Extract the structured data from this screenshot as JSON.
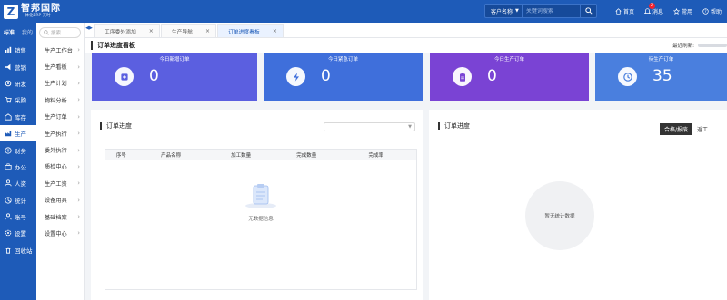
{
  "header": {
    "logo_letter": "Z",
    "brand_name": "智邦国际",
    "brand_slogan": "一体化ERP·天时",
    "search_scope": "客户名称",
    "search_placeholder": "关键词搜索",
    "actions": [
      {
        "icon": "home-icon",
        "label": "首页"
      },
      {
        "icon": "message-icon",
        "label": "消息",
        "badge": "2"
      },
      {
        "icon": "star-icon",
        "label": "常用"
      },
      {
        "icon": "help-icon",
        "label": "帮助"
      }
    ]
  },
  "rail": {
    "tabs": [
      "标准",
      "我的"
    ],
    "items": [
      {
        "label": "销售",
        "icon": "sales-icon"
      },
      {
        "label": "营销",
        "icon": "marketing-icon"
      },
      {
        "label": "研发",
        "icon": "rnd-icon"
      },
      {
        "label": "采购",
        "icon": "purchase-icon"
      },
      {
        "label": "库存",
        "icon": "inventory-icon"
      },
      {
        "label": "生产",
        "icon": "production-icon",
        "active": true
      },
      {
        "label": "财务",
        "icon": "finance-icon"
      },
      {
        "label": "办公",
        "icon": "office-icon"
      },
      {
        "label": "人资",
        "icon": "hr-icon"
      },
      {
        "label": "统计",
        "icon": "stats-icon"
      },
      {
        "label": "账号",
        "icon": "account-icon"
      },
      {
        "label": "设置",
        "icon": "settings-icon"
      },
      {
        "label": "回收站",
        "icon": "recycle-icon"
      }
    ]
  },
  "submenu": {
    "search_placeholder": "搜索",
    "items": [
      "生产工作台",
      "生产看板",
      "生产计划",
      "物料分析",
      "生产订单",
      "生产执行",
      "委外执行",
      "质检中心",
      "生产工资",
      "设备用具",
      "基础档案",
      "设置中心"
    ]
  },
  "tabs": [
    {
      "label": "工序委外添加",
      "active": false
    },
    {
      "label": "生产导航",
      "active": false
    },
    {
      "label": "订单进度看板",
      "active": true
    }
  ],
  "board": {
    "title": "订单进度看板",
    "refresh_label": "最近刷新:",
    "stats": [
      {
        "title": "今日新增订单",
        "value": "0",
        "color": "#5b5fe0",
        "icon": "add-order-icon"
      },
      {
        "title": "今日紧急订单",
        "value": "0",
        "color": "#3f6fdb",
        "icon": "lightning-icon"
      },
      {
        "title": "今日生产订单",
        "value": "0",
        "color": "#7a43d4",
        "icon": "clipboard-icon"
      },
      {
        "title": "待生产订单",
        "value": "35",
        "color": "#4a7fde",
        "icon": "clock-icon"
      }
    ]
  },
  "progress_left": {
    "title": "订单进度",
    "select_value": "",
    "columns": [
      "序号",
      "产品名称",
      "加工数量",
      "完成数量",
      "完成率"
    ],
    "empty_text": "无数据信息"
  },
  "progress_right": {
    "title": "订单进度",
    "segments": [
      "合格/报废",
      "返工"
    ],
    "empty_chart_text": "暂无统计数据"
  }
}
